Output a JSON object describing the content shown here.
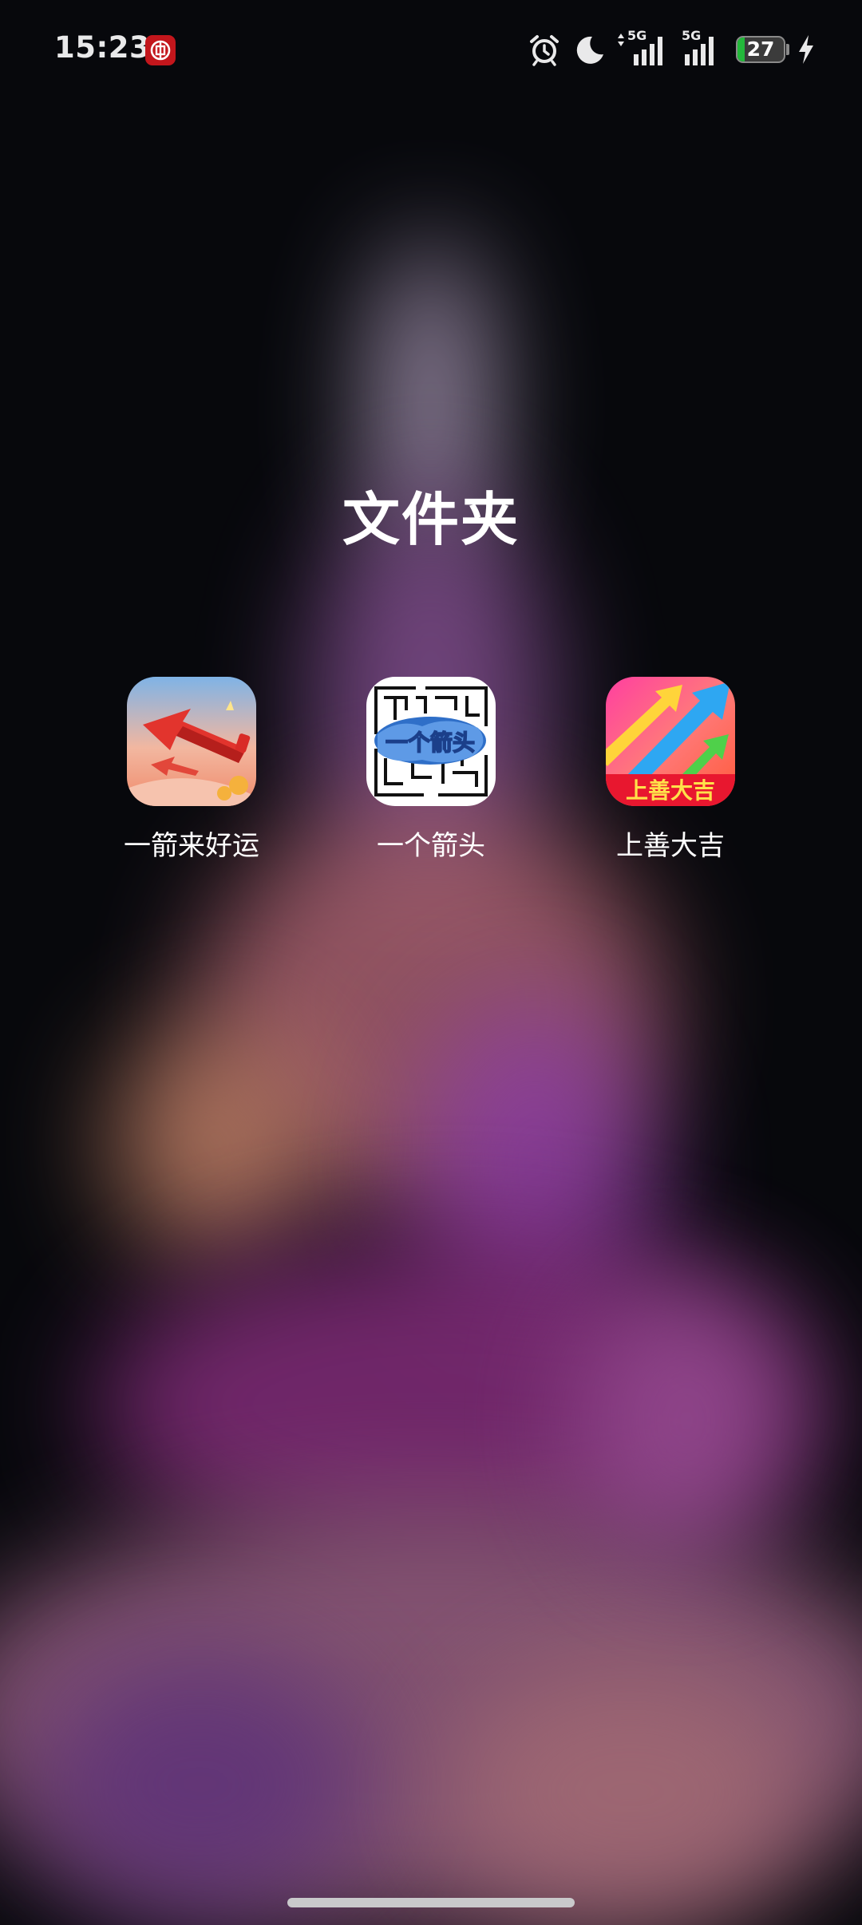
{
  "status_bar": {
    "time": "15:23",
    "network_1": "5G",
    "network_2": "5G",
    "battery_percent": 27,
    "battery_text": "27",
    "icons": [
      "bank-notification-icon",
      "alarm-icon",
      "do-not-disturb-moon-icon",
      "signal-5g-icon",
      "signal-5g-icon",
      "battery-icon",
      "charging-icon"
    ]
  },
  "folder": {
    "title": "文件夹",
    "apps": [
      {
        "label": "一箭来好运",
        "icon": "red-arrow-luck-app-icon"
      },
      {
        "label": "一个箭头",
        "icon": "arrow-maze-app-icon",
        "icon_text": "一个箭头"
      },
      {
        "label": "上善大吉",
        "icon": "rising-arrows-app-icon",
        "icon_text": "上善大吉"
      }
    ]
  },
  "colors": {
    "background": "#07080c",
    "battery_green": "#23b83b",
    "notification_red": "#c3161c"
  }
}
